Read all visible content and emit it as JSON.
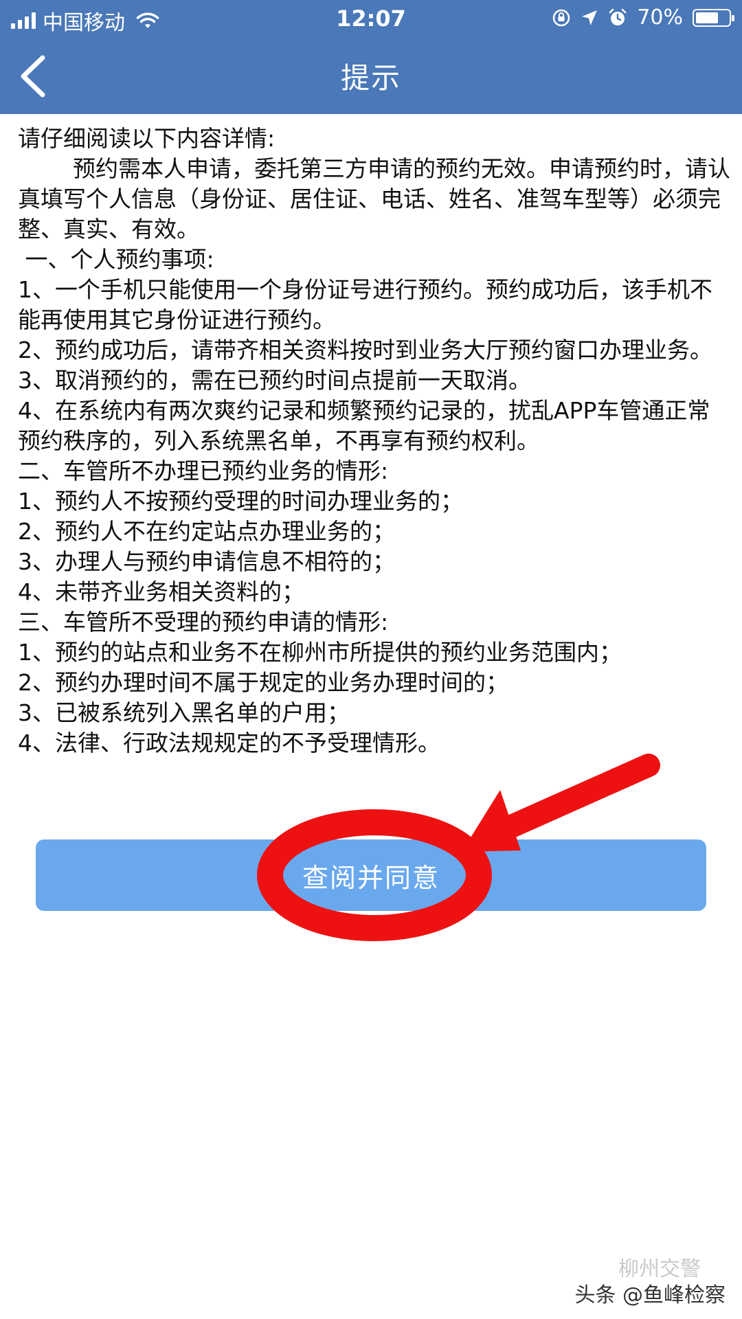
{
  "status_bar": {
    "carrier": "中国移动",
    "time": "12:07",
    "battery": "70%",
    "battery_level": 0.7
  },
  "nav": {
    "title": "提示",
    "back_icon": "chevron-left-icon"
  },
  "content": {
    "intro": "请仔细阅读以下内容详情:",
    "paragraph": "预约需本人申请，委托第三方申请的预约无效。申请预约时，请认真填写个人信息（身份证、居住证、电话、姓名、准驾车型等）必须完整、真实、有效。",
    "section1_title": " 一、个人预约事项:",
    "section1_items": [
      "1、一个手机只能使用一个身份证号进行预约。预约成功后，该手机不能再使用其它身份证进行预约。",
      "2、预约成功后，请带齐相关资料按时到业务大厅预约窗口办理业务。",
      "3、取消预约的，需在已预约时间点提前一天取消。",
      "4、在系统内有两次爽约记录和频繁预约记录的，扰乱APP车管通正常预约秩序的，列入系统黑名单，不再享有预约权利。"
    ],
    "section2_title": "二、车管所不办理已预约业务的情形:",
    "section2_items": [
      "1、预约人不按预约受理的时间办理业务的；",
      "2、预约人不在约定站点办理业务的；",
      "3、办理人与预约申请信息不相符的；",
      "4、未带齐业务相关资料的；"
    ],
    "section3_title": "三、车管所不受理的预约申请的情形:",
    "section3_items": [
      "1、预约的站点和业务不在柳州市所提供的预约业务范围内；",
      "2、预约办理时间不属于规定的业务办理时间的；",
      "3、已被系统列入黑名单的户用；",
      "4、法律、行政法规规定的不予受理情形。"
    ]
  },
  "button": {
    "agree_label": "查阅并同意"
  },
  "watermark": {
    "text": "头条 @鱼峰检察",
    "faint_text": "柳州交警"
  },
  "colors": {
    "header": "#4a78b8",
    "button": "#6aa8ee",
    "annotation": "#ee1111"
  }
}
